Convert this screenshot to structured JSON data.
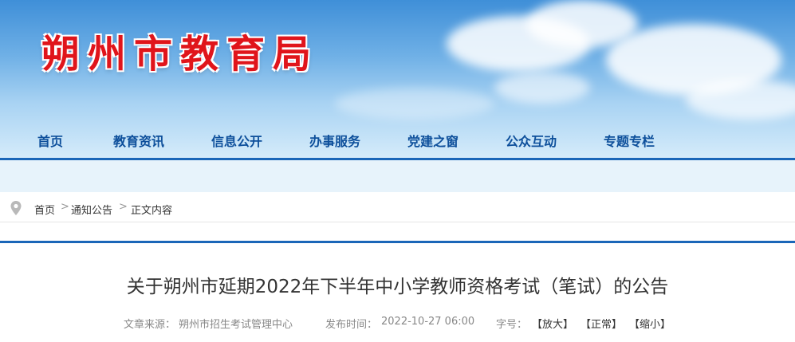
{
  "site": {
    "title": "朔州市教育局"
  },
  "nav": {
    "items": [
      {
        "label": "首页"
      },
      {
        "label": "教育资讯"
      },
      {
        "label": "信息公开"
      },
      {
        "label": "办事服务"
      },
      {
        "label": "党建之窗"
      },
      {
        "label": "公众互动"
      },
      {
        "label": "专题专栏"
      }
    ]
  },
  "breadcrumb": {
    "icon": "location-pin-icon",
    "items": [
      "首页",
      "通知公告",
      "正文内容"
    ],
    "separator": ">"
  },
  "article": {
    "title": "关于朔州市延期2022年下半年中小学教师资格考试（笔试）的公告",
    "source_label": "文章来源：",
    "source": "朔州市招生考试管理中心",
    "time_label": "发布时间：",
    "time": "2022-10-27 06:00",
    "font_label": "字号：",
    "font_large": "【放大】",
    "font_normal": "【正常】",
    "font_small": "【缩小】"
  },
  "colors": {
    "title_red": "#e0151b",
    "nav_blue": "#0d4f9b",
    "accent_line": "#1a66b8"
  }
}
